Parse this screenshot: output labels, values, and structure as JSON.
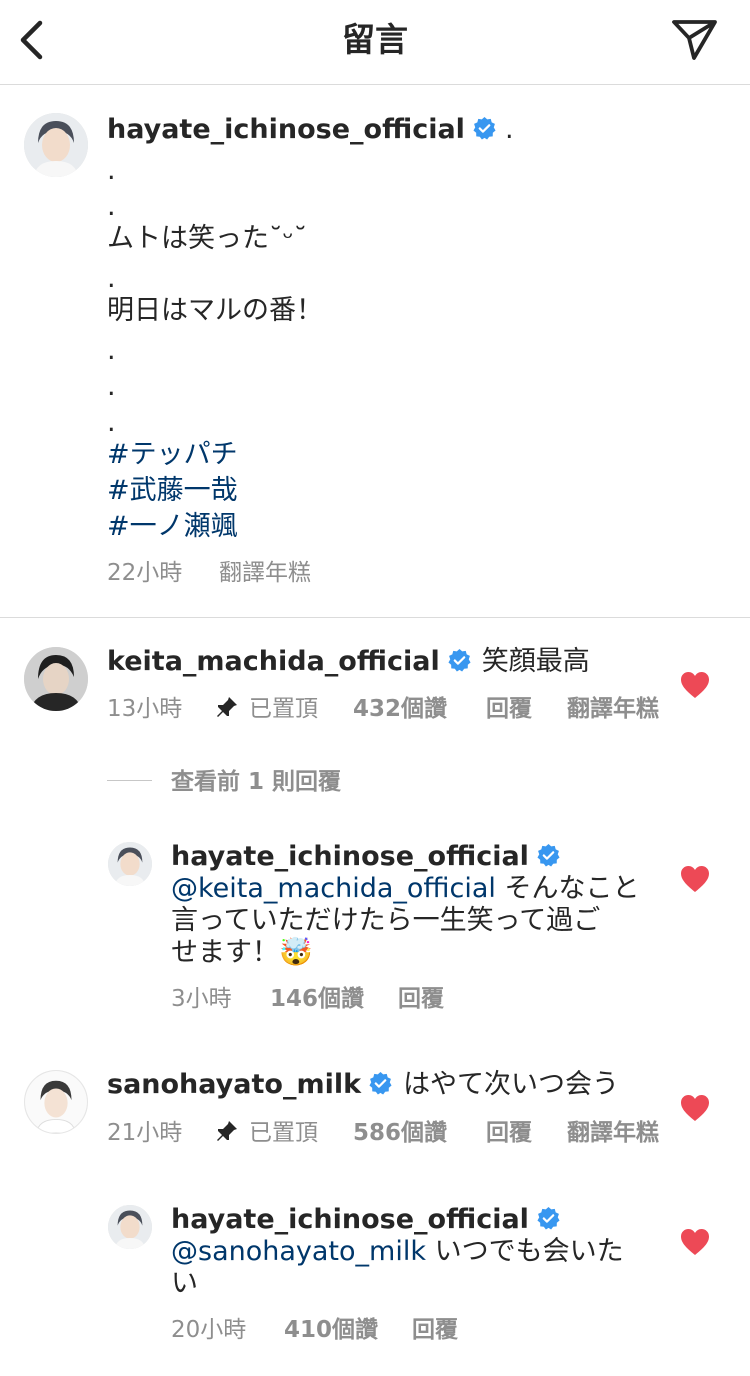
{
  "header": {
    "title": "留言"
  },
  "caption": {
    "username": "hayate_ichinose_official",
    "first": ".",
    "lines": [
      ".",
      ".",
      "ムトは笑った˘ᵕ˘",
      ".",
      "明日はマルの番！",
      ".",
      ".",
      "."
    ],
    "hashtags": [
      "#テッパチ",
      "#武藤一哉",
      "#一ノ瀬颯"
    ],
    "time": "22小時",
    "translate": "翻譯年糕"
  },
  "comments": [
    {
      "username": "keita_machida_official",
      "text": "笑顔最高",
      "time": "13小時",
      "pinned": "已置頂",
      "likes": "432個讚",
      "reply": "回覆",
      "translate": "翻譯年糕",
      "view_replies": "查看前 1 則回覆",
      "replies": [
        {
          "username": "hayate_ichinose_official",
          "mention": "@keita_machida_official",
          "lines": [
            " そんなこと",
            "言っていただけたら一生笑って過ご",
            "せます！🤯"
          ],
          "time": "3小時",
          "likes": "146個讚",
          "reply": "回覆"
        }
      ]
    },
    {
      "username": "sanohayato_milk",
      "text": "はやて次いつ会う",
      "time": "21小時",
      "pinned": "已置頂",
      "likes": "586個讚",
      "reply": "回覆",
      "translate": "翻譯年糕",
      "replies": [
        {
          "username": "hayate_ichinose_official",
          "mention": "@sanohayato_milk",
          "lines": [
            " いつでも会いた",
            "い"
          ],
          "time": "20小時",
          "likes": "410個讚",
          "reply": "回覆"
        }
      ]
    }
  ],
  "colors": {
    "link": "#00376b",
    "heart": "#ed4956",
    "verified": "#3897f0",
    "muted": "#8e8e8e"
  }
}
